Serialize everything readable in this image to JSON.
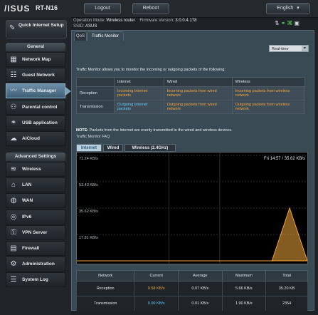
{
  "header": {
    "brand": "/ISUS",
    "model": "RT-N16",
    "logout_label": "Logout",
    "reboot_label": "Reboot",
    "language": "English"
  },
  "info": {
    "operation_mode_label": "Operation Mode:",
    "operation_mode_value": "Wireless router",
    "firmware_label": "Firmware Version:",
    "firmware_value": "3.0.0.4.178",
    "ssid_label": "SSID:",
    "ssid_value": "ASUS"
  },
  "sidebar": {
    "quick_setup_label": "Quick Internet Setup",
    "general_header": "General",
    "general_items": [
      {
        "label": "Network Map",
        "icon": "network-map-icon",
        "glyph": "▦"
      },
      {
        "label": "Guest Network",
        "icon": "guest-network-icon",
        "glyph": "☷"
      },
      {
        "label": "Traffic Manager",
        "icon": "traffic-manager-icon",
        "glyph": "〰"
      },
      {
        "label": "Parental control",
        "icon": "parental-control-icon",
        "glyph": "⚇"
      },
      {
        "label": "USB application",
        "icon": "usb-icon",
        "glyph": "⚭"
      },
      {
        "label": "AiCloud",
        "icon": "aicloud-icon",
        "glyph": "☁"
      }
    ],
    "advanced_header": "Advanced Settings",
    "advanced_items": [
      {
        "label": "Wireless",
        "icon": "wireless-icon",
        "glyph": "≋"
      },
      {
        "label": "LAN",
        "icon": "lan-icon",
        "glyph": "⌂"
      },
      {
        "label": "WAN",
        "icon": "wan-icon",
        "glyph": "◍"
      },
      {
        "label": "IPv6",
        "icon": "ipv6-icon",
        "glyph": "◎"
      },
      {
        "label": "VPN Server",
        "icon": "vpn-icon",
        "glyph": "⚿"
      },
      {
        "label": "Firewall",
        "icon": "firewall-icon",
        "glyph": "▤"
      },
      {
        "label": "Administration",
        "icon": "administration-icon",
        "glyph": "⚙"
      },
      {
        "label": "System Log",
        "icon": "system-log-icon",
        "glyph": "☰"
      }
    ]
  },
  "tabs": [
    {
      "label": "QoS"
    },
    {
      "label": "Traffic Monitor"
    }
  ],
  "monitor": {
    "mode_select": "Real-time",
    "description": "Traffic Monitor allows you to monitor the incoming or outgoing packets of the following:",
    "table_headers": [
      "",
      "Internet",
      "Wired",
      "Wireless"
    ],
    "rows": [
      {
        "label": "Reception",
        "internet": "Incoming Internet packets",
        "wired": "Incoming packets from wired network",
        "wireless": "Incoming packets from wireless network"
      },
      {
        "label": "Transmission",
        "internet": "Outgoing Internet packets",
        "wired": "Outgoing packets from wired network",
        "wireless": "Outgoing packets from wireless network"
      }
    ],
    "note_bold": "NOTE:",
    "note": "Packets from the Internet are evenly transmitted to the wired and wireless devices.",
    "faq_label": "Traffic Monitor FAQ",
    "chart_tabs": [
      "Internet",
      "Wired",
      "Wireless (2.4GHz)"
    ],
    "chart_readout": "Fri 14:57 / 35.62 KB/s",
    "stats_headers": [
      "Network",
      "Current",
      "Average",
      "Maximum",
      "Total"
    ],
    "stats_rows": [
      {
        "label": "Reception",
        "current": "0.58 KB/s",
        "average": "0.07 KB/s",
        "maximum": "5.66 KB/s",
        "total": "35.20 KB"
      },
      {
        "label": "Transmission",
        "current": "0.00 KB/s",
        "average": "0.01 KB/s",
        "maximum": "1.90 KB/s",
        "total": "2354"
      }
    ]
  },
  "chart_data": {
    "type": "area",
    "title": "",
    "xlabel": "",
    "ylabel": "",
    "y_ticks": [
      "71.24 KB/s",
      "53.43 KB/s",
      "35.62 KB/s",
      "17.81 KB/s"
    ],
    "ylim": [
      0,
      71.24
    ],
    "grid": true,
    "series": [
      {
        "values": [
          0,
          0,
          0,
          0,
          0,
          0,
          0,
          0,
          0,
          0,
          0,
          0,
          35.62,
          0
        ],
        "color": "#f0a53a"
      }
    ]
  },
  "colors": {
    "reception": "#f0a53a",
    "transmission": "#66c6f1",
    "active_tab": "#b8cfdd"
  }
}
